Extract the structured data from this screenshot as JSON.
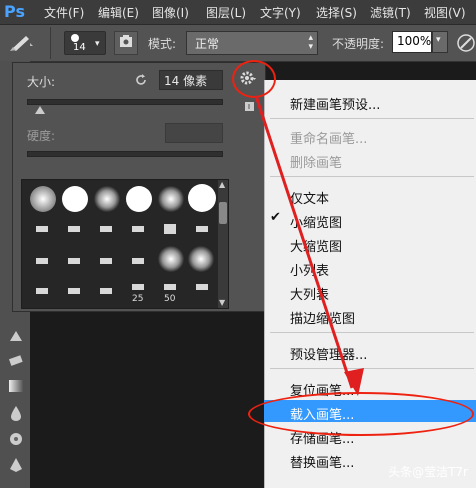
{
  "app": {
    "logo": "Ps"
  },
  "menubar": {
    "items": [
      "文件(F)",
      "编辑(E)",
      "图像(I)",
      "图层(L)",
      "文字(Y)",
      "选择(S)",
      "滤镜(T)",
      "视图(V)"
    ]
  },
  "options_bar": {
    "brush_size": "14",
    "mode_label": "模式:",
    "mode_value": "正常",
    "opacity_label": "不透明度:",
    "opacity_value": "100%"
  },
  "brush_panel": {
    "size_label": "大小:",
    "size_value": "14 像素",
    "hardness_label": "硬度:",
    "tip_numbers": [
      "25",
      "50"
    ]
  },
  "flyout_menu": {
    "items": [
      {
        "label": "新建画笔预设...",
        "enabled": true
      },
      {
        "label": "重命名画笔...",
        "enabled": false
      },
      {
        "label": "删除画笔",
        "enabled": false
      },
      {
        "label": "仅文本",
        "enabled": true
      },
      {
        "label": "小缩览图",
        "enabled": true,
        "checked": true
      },
      {
        "label": "大缩览图",
        "enabled": true
      },
      {
        "label": "小列表",
        "enabled": true
      },
      {
        "label": "大列表",
        "enabled": true
      },
      {
        "label": "描边缩览图",
        "enabled": true
      },
      {
        "label": "预设管理器...",
        "enabled": true
      },
      {
        "label": "复位画笔...",
        "enabled": true
      },
      {
        "label": "载入画笔...",
        "enabled": true,
        "highlighted": true
      },
      {
        "label": "存储画笔...",
        "enabled": true
      },
      {
        "label": "替换画笔...",
        "enabled": true
      }
    ]
  },
  "watermark": "头条@莹洁T7r",
  "colors": {
    "highlight": "#3399ff",
    "annotation": "#e02020"
  }
}
